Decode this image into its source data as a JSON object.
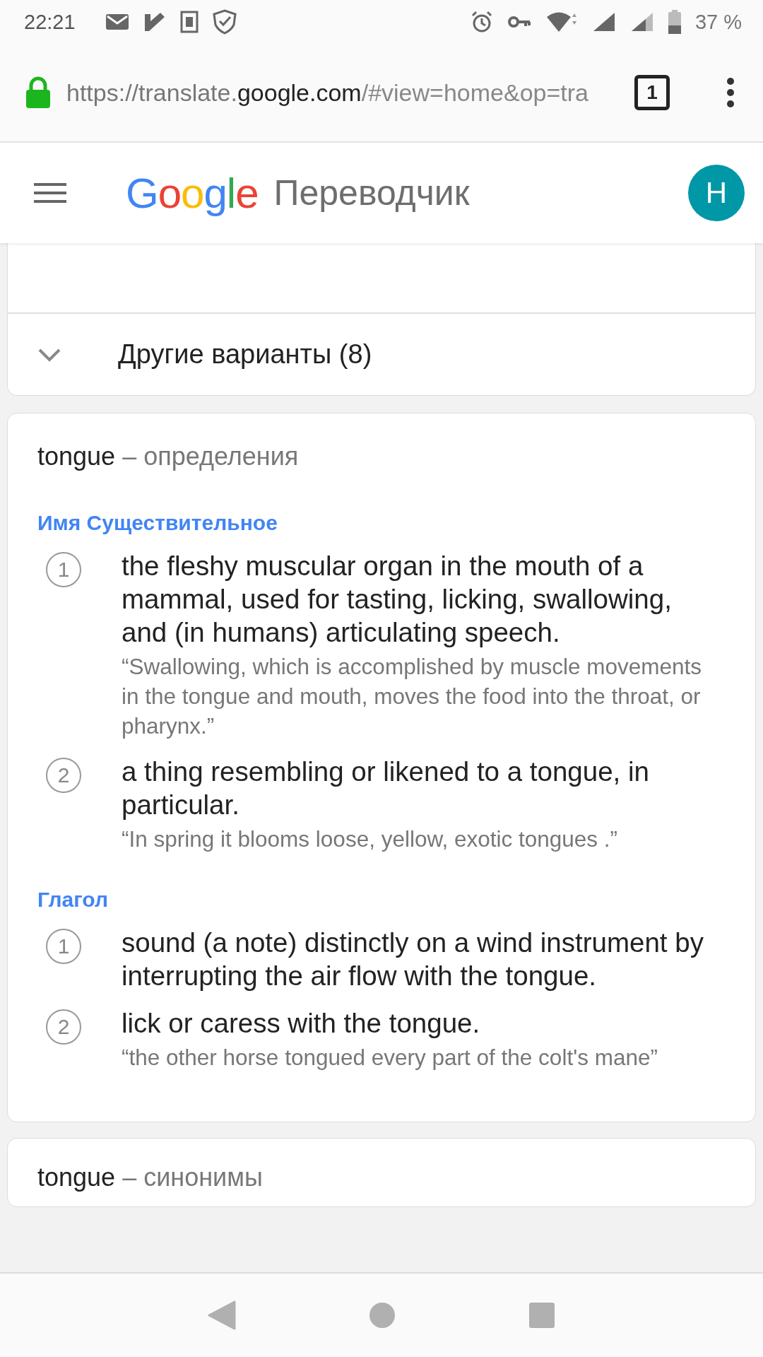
{
  "status_bar": {
    "time": "22:21",
    "battery": "37 %"
  },
  "address_bar": {
    "url_dim_start": "https://translate.",
    "url_domain": "google.com",
    "url_dim_end": "/#view=home&op=tra",
    "tab_count": "1"
  },
  "header": {
    "logo_letters": [
      {
        "char": "G",
        "color": "#4285f4"
      },
      {
        "char": "o",
        "color": "#ea4335"
      },
      {
        "char": "o",
        "color": "#fbbc05"
      },
      {
        "char": "g",
        "color": "#4285f4"
      },
      {
        "char": "l",
        "color": "#34a853"
      },
      {
        "char": "e",
        "color": "#ea4335"
      }
    ],
    "product": "Переводчик",
    "avatar": "H"
  },
  "alternatives": {
    "label": "Другие варианты (8)",
    "expanded": false
  },
  "definitions": {
    "word": "tongue",
    "suffix": "– определения",
    "groups": [
      {
        "part_of_speech": "Имя Существительное",
        "senses": [
          {
            "number": "1",
            "text": "the fleshy muscular organ in the mouth of a mammal, used for tasting, licking, swallowing, and (in humans) articulating speech.",
            "example": "“Swallowing, which is accomplished by muscle movements in the tongue and mouth, moves the food into the throat, or pharynx.”"
          },
          {
            "number": "2",
            "text": "a thing resembling or likened to a tongue, in particular.",
            "example": "“In spring it blooms loose, yellow, exotic tongues .”"
          }
        ]
      },
      {
        "part_of_speech": "Глагол",
        "senses": [
          {
            "number": "1",
            "text": "sound (a note) distinctly on a wind instrument by interrupting the air flow with the tongue."
          },
          {
            "number": "2",
            "text": "lick or caress with the tongue.",
            "example": "“the other horse tongued every part of the colt's mane”"
          }
        ]
      }
    ]
  },
  "synonyms": {
    "word": "tongue",
    "suffix": "– синонимы"
  }
}
